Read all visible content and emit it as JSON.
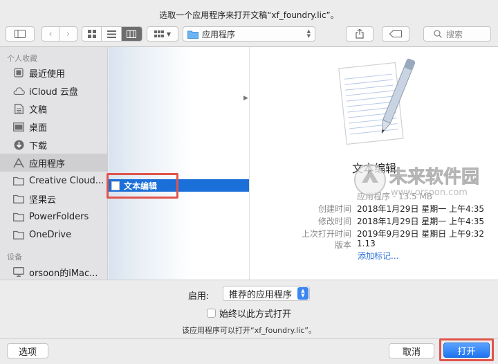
{
  "window": {
    "title": "选取一个应用程序来打开文稿“xf_foundry.lic”。"
  },
  "toolbar": {
    "path_label": "应用程序",
    "search_placeholder": "搜索"
  },
  "sidebar": {
    "favorites_header": "个人收藏",
    "items": [
      {
        "label": "最近使用",
        "icon": "clock-icon"
      },
      {
        "label": "iCloud 云盘",
        "icon": "cloud-icon"
      },
      {
        "label": "文稿",
        "icon": "document-icon"
      },
      {
        "label": "桌面",
        "icon": "desktop-icon"
      },
      {
        "label": "下载",
        "icon": "download-icon"
      },
      {
        "label": "应用程序",
        "icon": "applications-icon"
      },
      {
        "label": "Creative Cloud...",
        "icon": "folder-icon"
      },
      {
        "label": "坚果云",
        "icon": "folder-icon"
      },
      {
        "label": "PowerFolders",
        "icon": "folder-icon"
      },
      {
        "label": "OneDrive",
        "icon": "folder-icon"
      }
    ],
    "devices_header": "设备",
    "devices": [
      {
        "label": "orsoon的iMac...",
        "icon": "imac-icon"
      }
    ]
  },
  "column": {
    "selected_item": "文本编辑"
  },
  "preview": {
    "app_name": "文本编辑",
    "kind_key": "应用程序 - 13.5 MB",
    "meta": [
      {
        "key": "创建时间",
        "value": "2018年1月29日 星期一 上午4:35"
      },
      {
        "key": "修改时间",
        "value": "2018年1月29日 星期一 上午4:35"
      },
      {
        "key": "上次打开时间",
        "value": "2019年9月29日 星期日 上午9:32"
      },
      {
        "key": "版本",
        "value": "1.13"
      }
    ],
    "add_tags": "添加标记...",
    "watermark": "未来软件园 www.orsoon.com"
  },
  "bottom": {
    "enable_label": "启用:",
    "enable_value": "推荐的应用程序",
    "always_open_label": "始终以此方式打开",
    "note": "该应用程序可以打开“xf_foundry.lic”。",
    "options_button": "选项",
    "cancel_button": "取消",
    "open_button": "打开"
  }
}
